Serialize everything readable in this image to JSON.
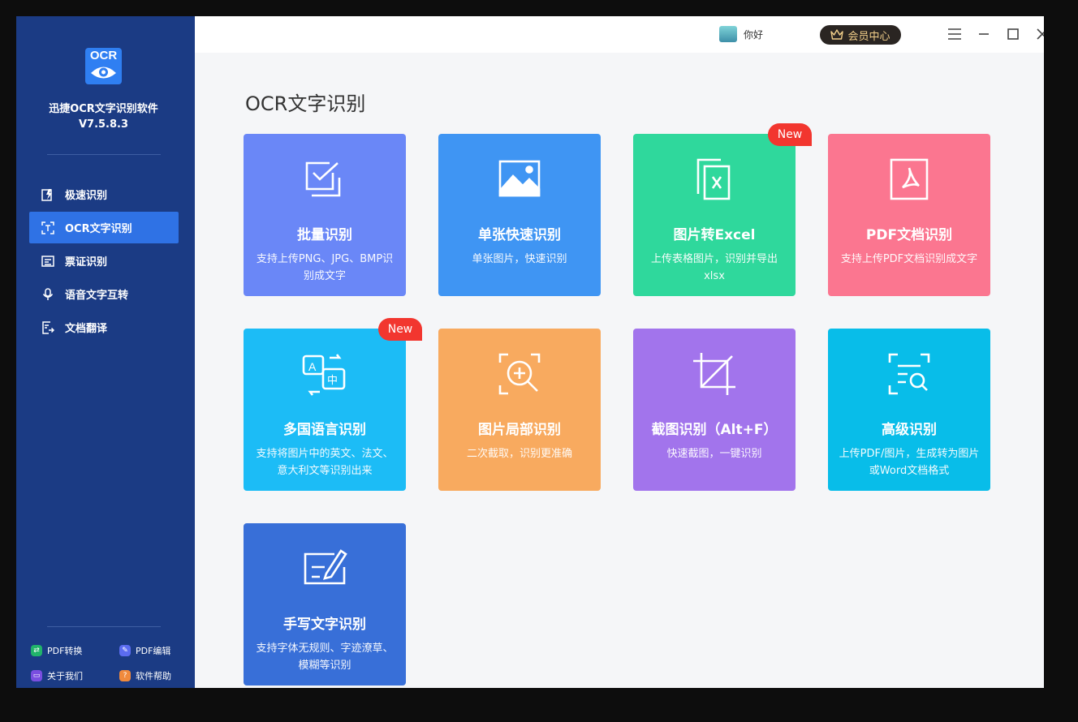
{
  "sidebar": {
    "logo_text": "OCR",
    "app_name": "迅捷OCR文字识别软件",
    "version": "V7.5.8.3",
    "items": [
      {
        "label": "极速识别",
        "icon": "lightning-doc-icon"
      },
      {
        "label": "OCR文字识别",
        "icon": "text-scan-icon",
        "active": true
      },
      {
        "label": "票证识别",
        "icon": "card-icon"
      },
      {
        "label": "语音文字互转",
        "icon": "microphone-icon"
      },
      {
        "label": "文档翻译",
        "icon": "doc-translate-icon"
      }
    ],
    "footer": [
      {
        "label": "PDF转换",
        "icon": "pdf-convert-icon",
        "color": "#21b36a"
      },
      {
        "label": "PDF编辑",
        "icon": "pdf-edit-icon",
        "color": "#5b6cf0"
      },
      {
        "label": "关于我们",
        "icon": "about-icon",
        "color": "#7a4ee0"
      },
      {
        "label": "软件帮助",
        "icon": "help-icon",
        "color": "#f08a3c"
      }
    ]
  },
  "topbar": {
    "username": "你好",
    "vip_label": "会员中心"
  },
  "main": {
    "title": "OCR文字识别",
    "badge_text": "New",
    "cards": [
      {
        "title": "批量识别",
        "desc": "支持上传PNG、JPG、BMP识别成文字",
        "color": "#6a87f7",
        "icon": "batch-check-icon"
      },
      {
        "title": "单张快速识别",
        "desc": "单张图片，快速识别",
        "color": "#3f95f3",
        "icon": "image-icon"
      },
      {
        "title": "图片转Excel",
        "desc": "上传表格图片，识别并导出xlsx",
        "color": "#2fd89c",
        "icon": "excel-icon",
        "new": true
      },
      {
        "title": "PDF文档识别",
        "desc": "支持上传PDF文档识别成文字",
        "color": "#fb7690",
        "icon": "pdf-icon"
      },
      {
        "title": "多国语言识别",
        "desc": "支持将图片中的英文、法文、意大利文等识别出来",
        "color": "#1cbcf6",
        "icon": "translate-icon",
        "new": true
      },
      {
        "title": "图片局部识别",
        "desc": "二次截取，识别更准确",
        "color": "#f8aa5f",
        "icon": "zoom-scan-icon"
      },
      {
        "title": "截图识别（Alt+F）",
        "desc": "快速截图，一键识别",
        "color": "#a274ec",
        "icon": "crop-icon"
      },
      {
        "title": "高级识别",
        "desc": "上传PDF/图片，生成转为图片或Word文档格式",
        "color": "#08bde9",
        "icon": "doc-search-icon"
      },
      {
        "title": "手写文字识别",
        "desc": "支持字体无规则、字迹潦草、模糊等识别",
        "color": "#386fd8",
        "icon": "handwrite-icon"
      }
    ]
  }
}
